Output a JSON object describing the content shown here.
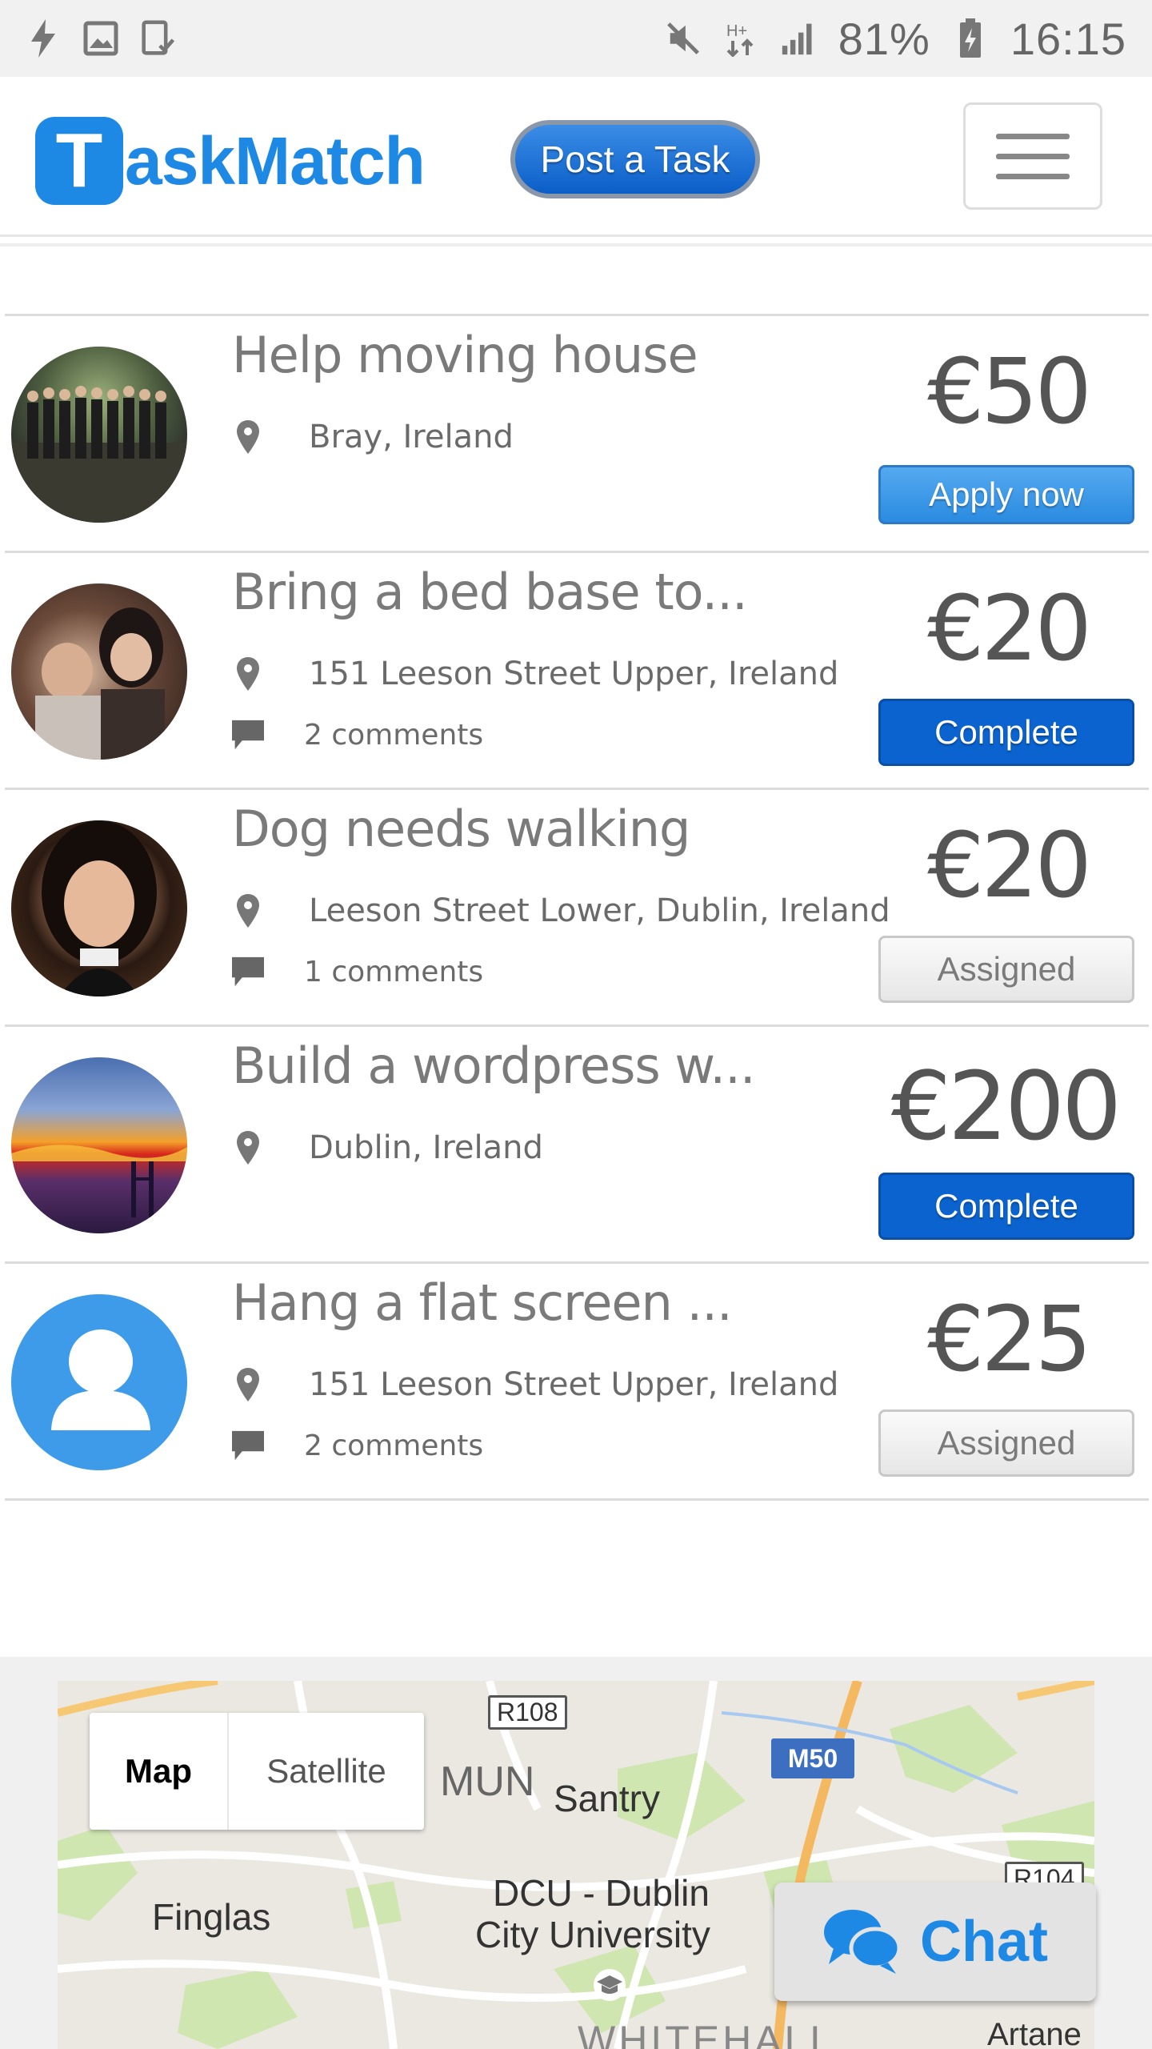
{
  "status_bar": {
    "battery": "81%",
    "time": "16:15",
    "icons_left": [
      "flash-icon",
      "image-icon",
      "device-check-icon"
    ],
    "icons_right": [
      "mute-icon",
      "data-arrows-icon",
      "signal-icon",
      "battery-charging-icon"
    ]
  },
  "header": {
    "logo_mark": "T",
    "logo_text": "askMatch",
    "post_task_label": "Post a Task",
    "menu_icon": "hamburger-menu-icon"
  },
  "tasks": [
    {
      "title": "Help moving house",
      "location": "Bray, Ireland",
      "comments": "",
      "price": "€50",
      "action": "Apply now",
      "action_style": "apply"
    },
    {
      "title": "Bring a bed base to...",
      "location": "151 Leeson Street Upper, Ireland",
      "comments": "2 comments",
      "price": "€20",
      "action": "Complete",
      "action_style": "complete"
    },
    {
      "title": "Dog needs walking",
      "location": "Leeson Street Lower, Dublin, Ireland",
      "comments": "1 comments",
      "price": "€20",
      "action": "Assigned",
      "action_style": "assigned"
    },
    {
      "title": "Build a wordpress w...",
      "location": "Dublin, Ireland",
      "comments": "",
      "price": "€200",
      "action": "Complete",
      "action_style": "complete"
    },
    {
      "title": "Hang a flat screen ...",
      "location": "151 Leeson Street Upper, Ireland",
      "comments": "2 comments",
      "price": "€25",
      "action": "Assigned",
      "action_style": "assigned"
    }
  ],
  "map": {
    "map_label": "Map",
    "satellite_label": "Satellite",
    "places": {
      "r108": "R108",
      "m50": "M50",
      "r104": "R104",
      "mun": "MUN",
      "santry": "Santry",
      "finglas": "Finglas",
      "dcu_line1": "DCU - Dublin",
      "dcu_line2": "City University",
      "whitehall": "WHITEHALL",
      "artane": "Artane"
    }
  },
  "chat": {
    "label": "Chat",
    "icon": "chat-bubbles-icon"
  },
  "colors": {
    "brand_blue": "#1e88e5",
    "complete_blue": "#0a63cf",
    "status_bar_bg": "#f1f1f1"
  }
}
